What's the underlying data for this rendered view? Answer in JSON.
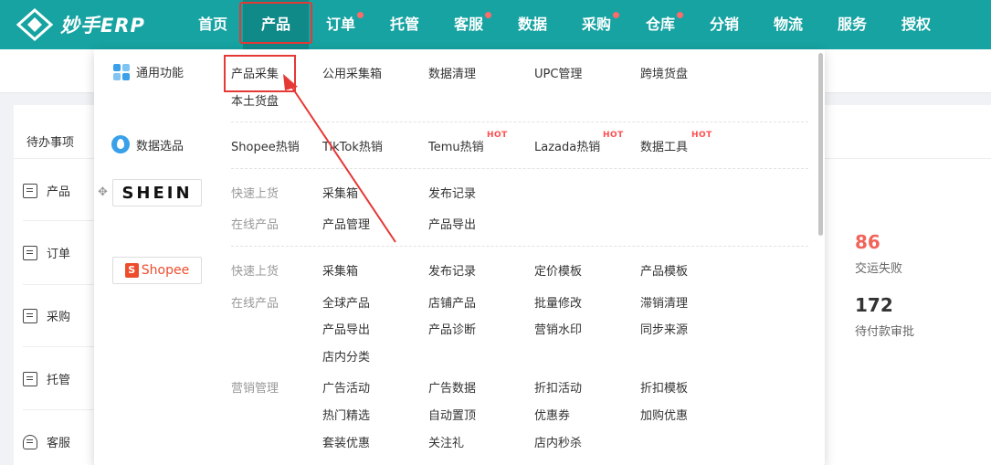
{
  "app": {
    "name": "妙手ERP"
  },
  "nav": {
    "items": [
      {
        "label": "首页"
      },
      {
        "label": "产品"
      },
      {
        "label": "订单"
      },
      {
        "label": "托管"
      },
      {
        "label": "客服"
      },
      {
        "label": "数据"
      },
      {
        "label": "采购"
      },
      {
        "label": "仓库"
      },
      {
        "label": "分销"
      },
      {
        "label": "物流"
      },
      {
        "label": "服务"
      },
      {
        "label": "授权"
      }
    ]
  },
  "background": {
    "todo_title": "待办事项",
    "side": [
      {
        "label": "产品",
        "icon": "doc-icon"
      },
      {
        "label": "订单",
        "icon": "list-icon"
      },
      {
        "label": "采购",
        "icon": "list-icon"
      },
      {
        "label": "托管",
        "icon": "list-icon"
      },
      {
        "label": "客服",
        "icon": "user-icon"
      }
    ],
    "stats": [
      {
        "value": "86",
        "label": "交运失败",
        "color": "#f0645a"
      },
      {
        "value": "172",
        "label": "待付款审批",
        "color": "#333333"
      }
    ]
  },
  "dropdown": {
    "categories": {
      "general": "通用功能",
      "data_select": "数据选品",
      "shein_logo": "SHEIN",
      "shopee_logo": "Shopee",
      "shopee_bag": "S"
    },
    "general_links": [
      "产品采集",
      "公用采集箱",
      "数据清理",
      "UPC管理",
      "跨境货盘",
      "本土货盘"
    ],
    "data_links": [
      "Shopee热销",
      "TikTok热销",
      "Temu热销",
      "Lazada热销",
      "数据工具"
    ],
    "hot_badge": "HOT",
    "shein": {
      "quick_label": "快速上货",
      "quick_links": [
        "采集箱",
        "发布记录"
      ],
      "online_label": "在线产品",
      "online_links": [
        "产品管理",
        "产品导出"
      ]
    },
    "shopee": {
      "quick_label": "快速上货",
      "quick_links": [
        "采集箱",
        "发布记录",
        "定价模板",
        "产品模板"
      ],
      "online_label": "在线产品",
      "online_links": [
        "全球产品",
        "店铺产品",
        "批量修改",
        "滞销清理",
        "产品导出",
        "产品诊断",
        "营销水印",
        "同步来源",
        "店内分类"
      ],
      "marketing_label": "营销管理",
      "marketing_links": [
        "广告活动",
        "广告数据",
        "折扣活动",
        "折扣模板",
        "热门精选",
        "自动置顶",
        "优惠券",
        "加购优惠",
        "套装优惠",
        "关注礼",
        "店内秒杀"
      ]
    }
  },
  "colors": {
    "brand": "#16a3a2",
    "brand_active": "#0f8a89",
    "highlight": "#e53935",
    "hot": "#ff4d4f"
  }
}
